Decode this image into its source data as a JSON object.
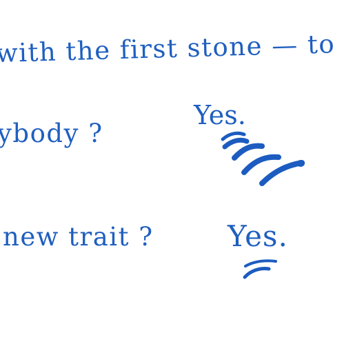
{
  "document": {
    "line_1": "with the first stone — to",
    "line_2": "ybody  ?",
    "line_3": "new trait   ?",
    "answer_1": "Yes.",
    "answer_2": "Yes."
  },
  "colors": {
    "ink": "#1f5fbf",
    "scribble": "#1c5cc0",
    "background": "#ffffff"
  }
}
